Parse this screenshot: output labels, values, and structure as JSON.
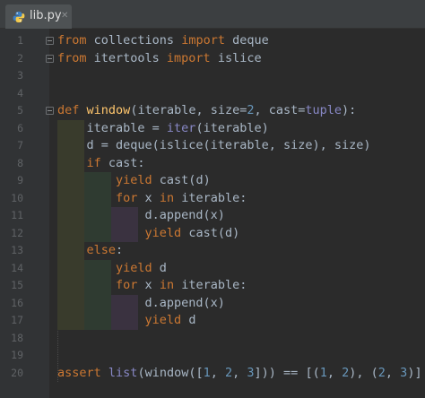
{
  "tab": {
    "filename": "lib.py",
    "close_glyph": "✕",
    "icon": "python-file-icon"
  },
  "colors": {
    "background": "#2b2b2b",
    "gutter": "#313335",
    "keyword": "#cc7832",
    "function_name": "#ffc66d",
    "number": "#6897bb",
    "builtin": "#8888c6",
    "plain": "#a9b7c6",
    "line_number": "#606366"
  },
  "line_numbers": [
    "1",
    "2",
    "3",
    "4",
    "5",
    "6",
    "7",
    "8",
    "9",
    "10",
    "11",
    "12",
    "13",
    "14",
    "15",
    "16",
    "17",
    "18",
    "19",
    "20"
  ],
  "code_lines": [
    [
      {
        "kind": "kw",
        "text": "from"
      },
      {
        "kind": "plain",
        "text": " collections "
      },
      {
        "kind": "kw",
        "text": "import"
      },
      {
        "kind": "plain",
        "text": " deque"
      }
    ],
    [
      {
        "kind": "kw",
        "text": "from"
      },
      {
        "kind": "plain",
        "text": " itertools "
      },
      {
        "kind": "kw",
        "text": "import"
      },
      {
        "kind": "plain",
        "text": " islice"
      }
    ],
    [],
    [],
    [
      {
        "kind": "kw",
        "text": "def"
      },
      {
        "kind": "plain",
        "text": " "
      },
      {
        "kind": "fn",
        "text": "window"
      },
      {
        "kind": "plain",
        "text": "(iterable, size="
      },
      {
        "kind": "num",
        "text": "2"
      },
      {
        "kind": "plain",
        "text": ", cast="
      },
      {
        "kind": "builtin",
        "text": "tuple"
      },
      {
        "kind": "plain",
        "text": "):"
      }
    ],
    [
      {
        "kind": "plain",
        "text": "    iterable = "
      },
      {
        "kind": "builtin",
        "text": "iter"
      },
      {
        "kind": "plain",
        "text": "(iterable)"
      }
    ],
    [
      {
        "kind": "plain",
        "text": "    d = deque(islice(iterable, size), size)"
      }
    ],
    [
      {
        "kind": "plain",
        "text": "    "
      },
      {
        "kind": "kw",
        "text": "if"
      },
      {
        "kind": "plain",
        "text": " cast:"
      }
    ],
    [
      {
        "kind": "plain",
        "text": "        "
      },
      {
        "kind": "kw",
        "text": "yield"
      },
      {
        "kind": "plain",
        "text": " cast(d)"
      }
    ],
    [
      {
        "kind": "plain",
        "text": "        "
      },
      {
        "kind": "kw",
        "text": "for"
      },
      {
        "kind": "plain",
        "text": " x "
      },
      {
        "kind": "kw",
        "text": "in"
      },
      {
        "kind": "plain",
        "text": " iterable:"
      }
    ],
    [
      {
        "kind": "plain",
        "text": "            d.append(x)"
      }
    ],
    [
      {
        "kind": "plain",
        "text": "            "
      },
      {
        "kind": "kw",
        "text": "yield"
      },
      {
        "kind": "plain",
        "text": " cast(d)"
      }
    ],
    [
      {
        "kind": "plain",
        "text": "    "
      },
      {
        "kind": "kw",
        "text": "else"
      },
      {
        "kind": "plain",
        "text": ":"
      }
    ],
    [
      {
        "kind": "plain",
        "text": "        "
      },
      {
        "kind": "kw",
        "text": "yield"
      },
      {
        "kind": "plain",
        "text": " d"
      }
    ],
    [
      {
        "kind": "plain",
        "text": "        "
      },
      {
        "kind": "kw",
        "text": "for"
      },
      {
        "kind": "plain",
        "text": " x "
      },
      {
        "kind": "kw",
        "text": "in"
      },
      {
        "kind": "plain",
        "text": " iterable:"
      }
    ],
    [
      {
        "kind": "plain",
        "text": "            d.append(x)"
      }
    ],
    [
      {
        "kind": "plain",
        "text": "            "
      },
      {
        "kind": "kw",
        "text": "yield"
      },
      {
        "kind": "plain",
        "text": " d"
      }
    ],
    [],
    [],
    [
      {
        "kind": "kw",
        "text": "assert"
      },
      {
        "kind": "plain",
        "text": " "
      },
      {
        "kind": "builtin",
        "text": "list"
      },
      {
        "kind": "plain",
        "text": "(window(["
      },
      {
        "kind": "num",
        "text": "1"
      },
      {
        "kind": "plain",
        "text": ", "
      },
      {
        "kind": "num",
        "text": "2"
      },
      {
        "kind": "plain",
        "text": ", "
      },
      {
        "kind": "num",
        "text": "3"
      },
      {
        "kind": "plain",
        "text": "])) == [("
      },
      {
        "kind": "num",
        "text": "1"
      },
      {
        "kind": "plain",
        "text": ", "
      },
      {
        "kind": "num",
        "text": "2"
      },
      {
        "kind": "plain",
        "text": "), ("
      },
      {
        "kind": "num",
        "text": "2"
      },
      {
        "kind": "plain",
        "text": ", "
      },
      {
        "kind": "num",
        "text": "3"
      },
      {
        "kind": "plain",
        "text": ")]"
      }
    ]
  ]
}
